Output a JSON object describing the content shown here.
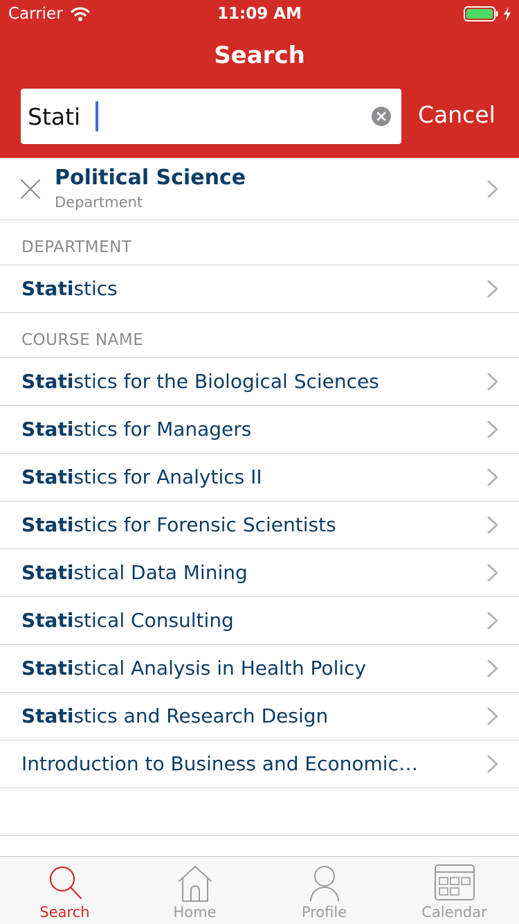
{
  "status_bar": {
    "carrier": "Carrier",
    "time": "11:09 AM"
  },
  "header": {
    "title": "Search",
    "cancel_label": "Cancel"
  },
  "search": {
    "value": "Stati"
  },
  "recent": {
    "title": "Political Science",
    "subtitle": "Department"
  },
  "sections": [
    {
      "header": "DEPARTMENT",
      "items": [
        {
          "match": "Stati",
          "rest": "stics"
        }
      ]
    },
    {
      "header": "COURSE NAME",
      "items": [
        {
          "match": "Stati",
          "rest": "stics for the Biological Sciences"
        },
        {
          "match": "Stati",
          "rest": "stics for Managers"
        },
        {
          "match": "Stati",
          "rest": "stics for Analytics II"
        },
        {
          "match": "Stati",
          "rest": "stics for Forensic Scientists"
        },
        {
          "match": "Stati",
          "rest": "stical Data Mining"
        },
        {
          "match": "Stati",
          "rest": "stical Consulting"
        },
        {
          "match": "Stati",
          "rest": "stical Analysis in Health Policy"
        },
        {
          "match": "Stati",
          "rest": "stics and Research Design"
        },
        {
          "match": "",
          "rest": "Introduction to Business and Economic…"
        }
      ]
    }
  ],
  "tabs": [
    {
      "label": "Search",
      "icon": "magnifier-icon",
      "active": true
    },
    {
      "label": "Home",
      "icon": "home-icon",
      "active": false
    },
    {
      "label": "Profile",
      "icon": "person-icon",
      "active": false
    },
    {
      "label": "Calendar",
      "icon": "calendar-icon",
      "active": false
    }
  ],
  "colors": {
    "header_bg": "#d22b26",
    "text_primary": "#0d3d66",
    "text_secondary": "#8a8a8a",
    "tab_active": "#d22b26",
    "tab_inactive": "#9b9b9b",
    "caret": "#3d6bd9",
    "battery": "#4cd964"
  }
}
